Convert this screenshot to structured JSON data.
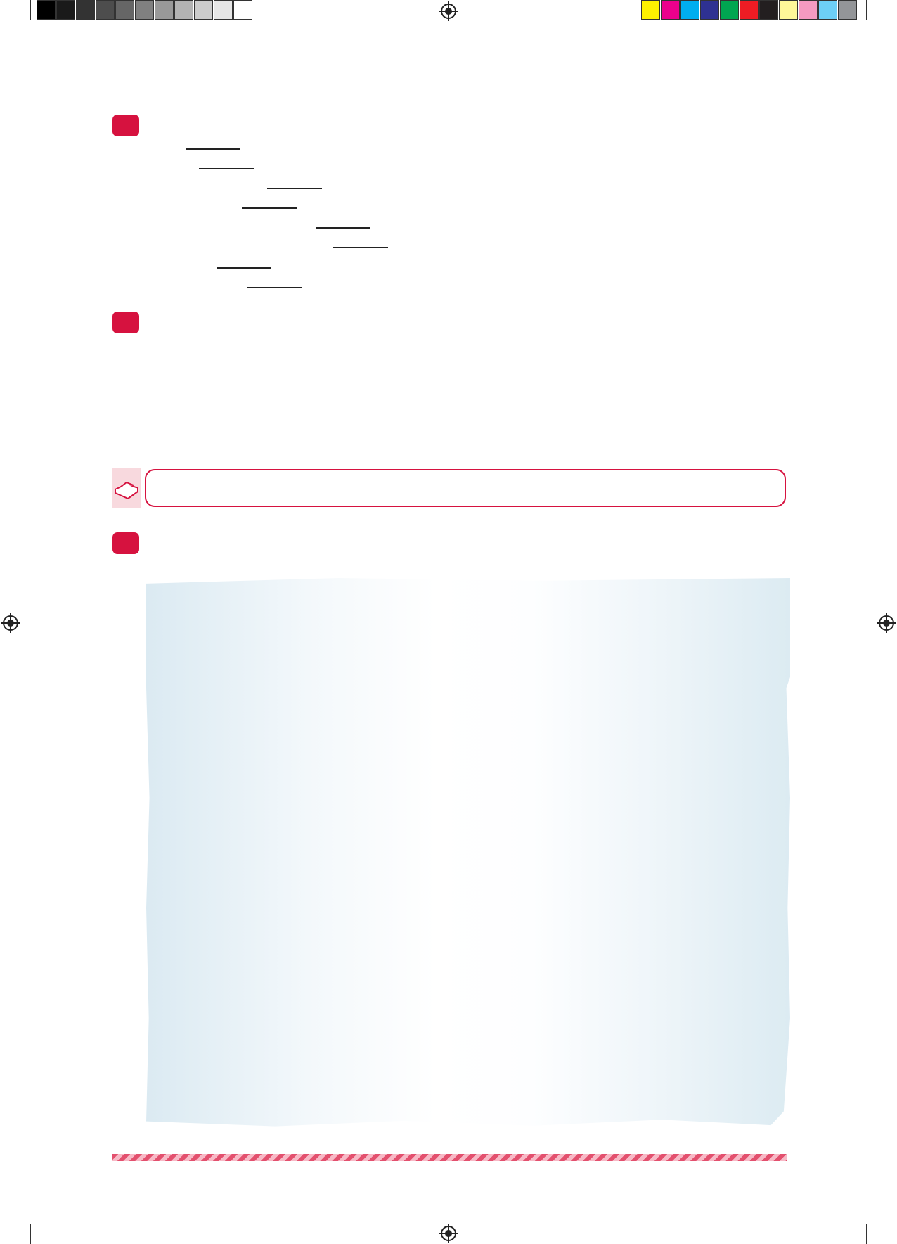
{
  "colors": {
    "accent": "#d6123f",
    "note_fill": "#f8d9de",
    "paper_edge": "#dbeaf2",
    "grayscale_bar": [
      "#000000",
      "#1a1a1a",
      "#333333",
      "#4d4d4d",
      "#666666",
      "#808080",
      "#999999",
      "#b3b3b3",
      "#cccccc",
      "#e6e6e6",
      "#ffffff"
    ],
    "color_bar": [
      "#fff200",
      "#ec008c",
      "#00aeef",
      "#2e3192",
      "#00a651",
      "#ed1c24",
      "#231f20",
      "#fff799",
      "#f49ac1",
      "#6dcff6",
      "#939598"
    ]
  },
  "icons": {
    "note": "open-book-icon",
    "registration": "registration-mark-icon"
  },
  "exercises": [
    {
      "blank_count": 8
    },
    {
      "blank_count": 0
    },
    {
      "blank_count": 0
    }
  ]
}
